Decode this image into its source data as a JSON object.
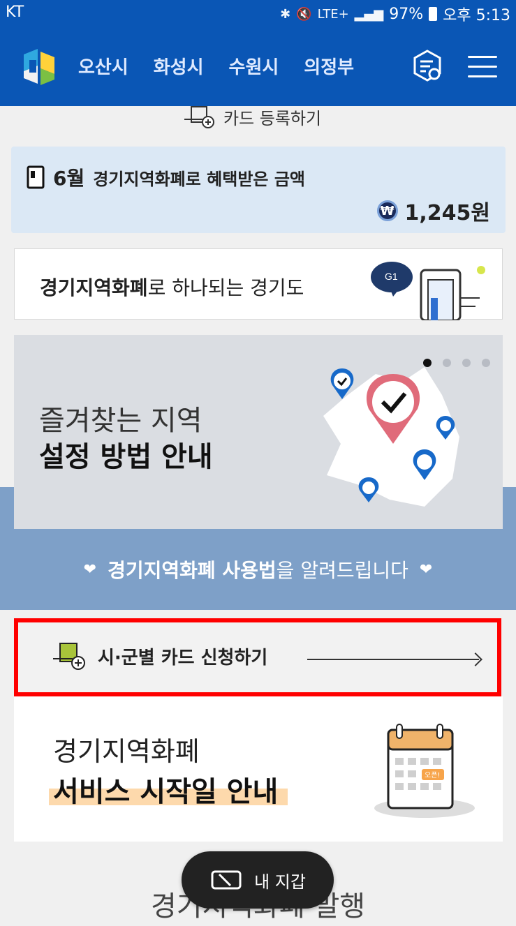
{
  "status_bar": {
    "carrier": "KT",
    "network": "LTE+",
    "battery": "97%",
    "time": "오후 5:13"
  },
  "header": {
    "nav": [
      "오산시",
      "화성시",
      "수원시",
      "의정부"
    ],
    "brand_color": "#0a56b5"
  },
  "register_card": {
    "label": "카드 등록하기"
  },
  "benefit": {
    "month": "6월",
    "title": "경기지역화폐로 혜택받은 금액",
    "currency_symbol": "₩",
    "amount": "1,245원"
  },
  "banner": {
    "bold": "경기지역화폐",
    "rest": "로 하나되는 경기도"
  },
  "slider": {
    "line1": "즐겨찾는 지역",
    "line2": "설정 방법 안내",
    "active_index": 0
  },
  "usage": {
    "bold": "경기지역화폐 사용법",
    "rest": "을 알려드립니다"
  },
  "apply": {
    "label": "시·군별 카드 신청하기"
  },
  "service": {
    "line1": "경기지역화폐",
    "line2": "서비스 시작일 안내",
    "calendar_badge": "오픈!"
  },
  "wallet_button": {
    "label": "내 지갑"
  },
  "bottom_title": "경기지역화폐 발행"
}
